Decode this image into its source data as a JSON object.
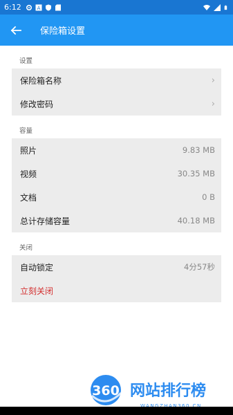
{
  "status_bar": {
    "time": "6:12",
    "icons": [
      "gear-icon",
      "a-box-icon",
      "shield-icon",
      "sd-card-icon"
    ],
    "right_icons": [
      "wifi-icon",
      "signal-icon",
      "battery-icon"
    ]
  },
  "app_bar": {
    "back_icon": "arrow-left-icon",
    "title": "保险箱设置"
  },
  "sections": [
    {
      "label": "设置",
      "rows": [
        {
          "label": "保险箱名称",
          "chevron": "›"
        },
        {
          "label": "修改密码",
          "chevron": "›"
        }
      ]
    },
    {
      "label": "容量",
      "rows": [
        {
          "label": "照片",
          "value": "9.83 MB"
        },
        {
          "label": "视频",
          "value": "30.35 MB"
        },
        {
          "label": "文档",
          "value": "0 B"
        },
        {
          "label": "总计存储容量",
          "value": "40.18 MB"
        }
      ]
    },
    {
      "label": "关闭",
      "rows": [
        {
          "label": "自动锁定",
          "value": "4分57秒"
        },
        {
          "label": "立刻关闭"
        }
      ]
    }
  ],
  "watermark": {
    "logo_text": "360",
    "title": "网站排行榜",
    "url": "WANGZHAN360.CN"
  },
  "colors": {
    "status_bar": "#1976d2",
    "app_bar": "#2196f3",
    "group_bg": "#ececec",
    "danger": "#d32f2f"
  }
}
